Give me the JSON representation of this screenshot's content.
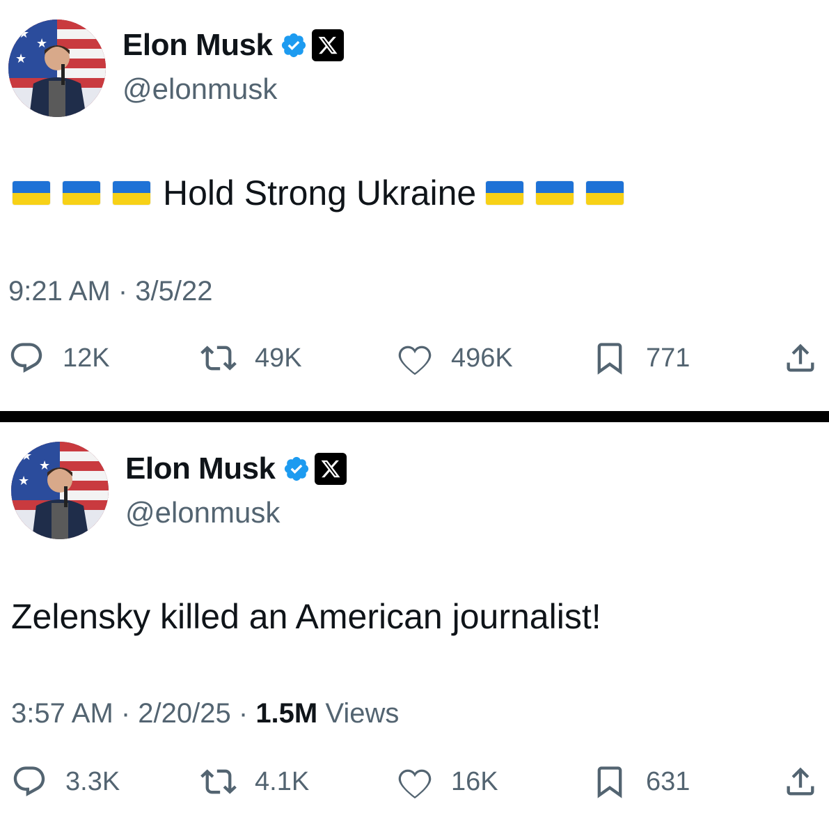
{
  "tweets": [
    {
      "author": {
        "name": "Elon Musk",
        "handle": "@elonmusk"
      },
      "text": "Hold Strong Ukraine",
      "flags_before": 3,
      "flags_after": 3,
      "timestamp": "9:21 AM · 3/5/22",
      "views_count": "",
      "views_label": "",
      "stats": {
        "replies": "12K",
        "reposts": "49K",
        "likes": "496K",
        "bookmarks": "771"
      }
    },
    {
      "author": {
        "name": "Elon Musk",
        "handle": "@elonmusk"
      },
      "text": "Zelensky killed an American journalist!",
      "timestamp": "3:57 AM · 2/20/25 · ",
      "views_count": "1.5M",
      "views_label": " Views",
      "stats": {
        "replies": "3.3K",
        "reposts": "4.1K",
        "likes": "16K",
        "bookmarks": "631"
      }
    }
  ],
  "colors": {
    "text": "#0f1419",
    "secondary": "#536471",
    "verified": "#1d9bf0",
    "flag_blue": "#1e72d6",
    "flag_yellow": "#f7d117"
  },
  "icons": {
    "reply": "speech-bubble-icon",
    "repost": "repost-arrows-icon",
    "like": "heart-icon",
    "bookmark": "bookmark-icon",
    "share": "share-upload-icon"
  }
}
